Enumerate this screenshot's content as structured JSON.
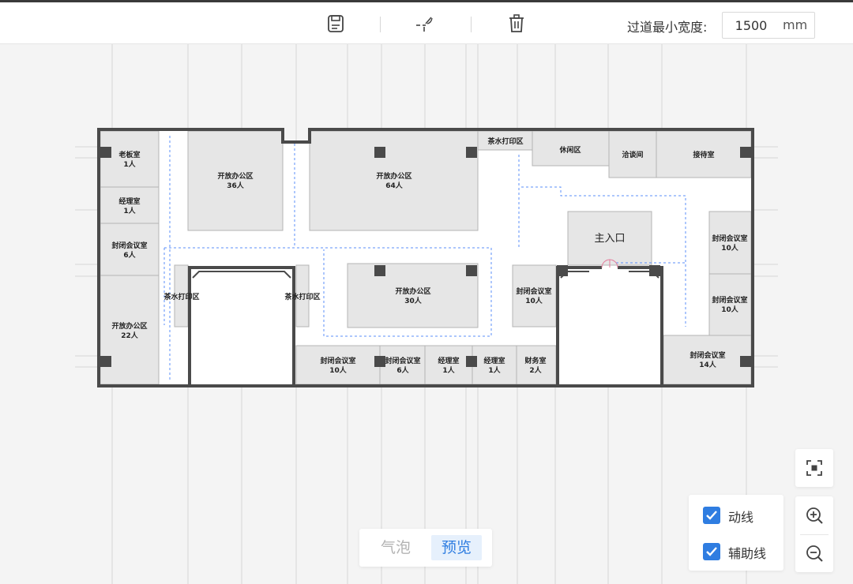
{
  "toolbar": {
    "icons": [
      "save-icon",
      "auto-layout-icon",
      "trash-icon"
    ],
    "min_corridor_label": "过道最小宽度:",
    "min_corridor_value": "1500",
    "min_corridor_unit": "mm"
  },
  "floorplan": {
    "rooms": [
      {
        "name": "老板室",
        "count": "1人"
      },
      {
        "name": "经理室",
        "count": "1人"
      },
      {
        "name": "封闭会议室",
        "count": "6人"
      },
      {
        "name": "开放办公区",
        "count": "22人"
      },
      {
        "name": "开放办公区",
        "count": "36人"
      },
      {
        "name": "开放办公区",
        "count": "64人"
      },
      {
        "name": "茶水打印区",
        "count": ""
      },
      {
        "name": "休闲区",
        "count": ""
      },
      {
        "name": "洽谈间",
        "count": ""
      },
      {
        "name": "接待室",
        "count": ""
      },
      {
        "name": "主入口",
        "count": ""
      },
      {
        "name": "封闭会议室",
        "count": "10人"
      },
      {
        "name": "封闭会议室",
        "count": "10人"
      },
      {
        "name": "茶水打印区",
        "count": ""
      },
      {
        "name": "茶水打印区",
        "count": ""
      },
      {
        "name": "开放办公区",
        "count": "30人"
      },
      {
        "name": "封闭会议室",
        "count": "10人"
      },
      {
        "name": "封闭会议室",
        "count": "10人"
      },
      {
        "name": "封闭会议室",
        "count": "6人"
      },
      {
        "name": "经理室",
        "count": "1人"
      },
      {
        "name": "经理室",
        "count": "1人"
      },
      {
        "name": "财务室",
        "count": "2人"
      },
      {
        "name": "封闭会议室",
        "count": "14人"
      }
    ]
  },
  "controls": {
    "fit_icon": "fit-view-icon",
    "zoom_in_icon": "zoom-in-icon",
    "zoom_out_icon": "zoom-out-icon",
    "toggles": [
      {
        "label": "动线",
        "checked": true
      },
      {
        "label": "辅助线",
        "checked": true
      }
    ],
    "modes": [
      {
        "label": "气泡",
        "active": false
      },
      {
        "label": "预览",
        "active": true
      }
    ]
  },
  "colors": {
    "accent": "#2f7de1",
    "wall": "#4a4a4a",
    "room_fill": "#e6e6e6",
    "route_line": "#5b8ff9"
  }
}
